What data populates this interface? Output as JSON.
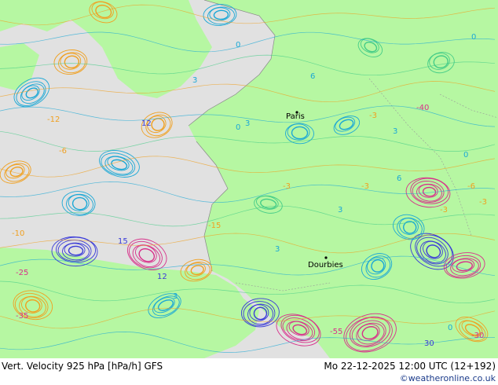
{
  "footer": {
    "title": "Vert. Velocity 925 hPa [hPa/h] GFS",
    "datetime": "Mo 22-12-2025 12:00 UTC (12+192)",
    "credit": "©weatheronline.co.uk"
  },
  "cities": [
    {
      "name": "Paris"
    },
    {
      "name": "Dourbies"
    }
  ],
  "contour_labels": [
    "3",
    "0",
    "3",
    "6",
    "12",
    "-3",
    "-6",
    "-12",
    "-15",
    "-25",
    "-35",
    "-10",
    "15",
    "12",
    "3",
    "0",
    "-3",
    "-40",
    "-55",
    "-30",
    "30",
    "6",
    "-3",
    "-6",
    "3",
    "0",
    "-3",
    "3",
    "-3",
    "0",
    "3",
    "0"
  ],
  "colors": {
    "land": "#b6f7a2",
    "sea": "#e1e1e1",
    "positive_contours": "#1ba8d6",
    "negative_contours": "#f0a020",
    "strong_negative": "#d8308a",
    "strong_positive": "#3b3bd8",
    "weak_contours": "#44cc88"
  },
  "units": "hPa/h"
}
